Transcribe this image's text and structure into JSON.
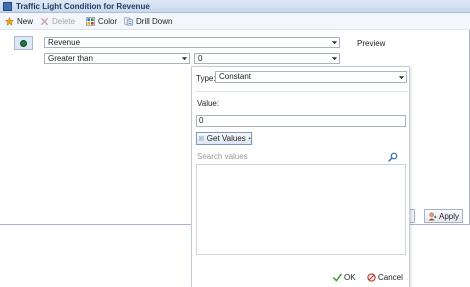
{
  "window": {
    "title": "Traffic Light Condition for Revenue",
    "icon": "app-icon"
  },
  "toolbar": {
    "new_label": "New",
    "delete_label": "Delete",
    "color_label": "Color",
    "drill_down_label": "Drill Down"
  },
  "condition": {
    "status_color": "#1f7a3c",
    "field_value": "Revenue",
    "operator_value": "Greater than",
    "value_value": "0",
    "preview_label": "Preview"
  },
  "value_panel": {
    "type_label": "Type:",
    "type_value": "Constant",
    "value_label": "Value:",
    "value_input": "0",
    "get_values_label": "Get Values",
    "search_placeholder": "Search values",
    "ok_label": "OK",
    "cancel_label": "Cancel"
  },
  "footer": {
    "apply_label": "Apply"
  },
  "colors": {
    "accent": "#3f6fb3",
    "ok_green": "#3a9a2e",
    "cancel_red": "#c0392b"
  }
}
